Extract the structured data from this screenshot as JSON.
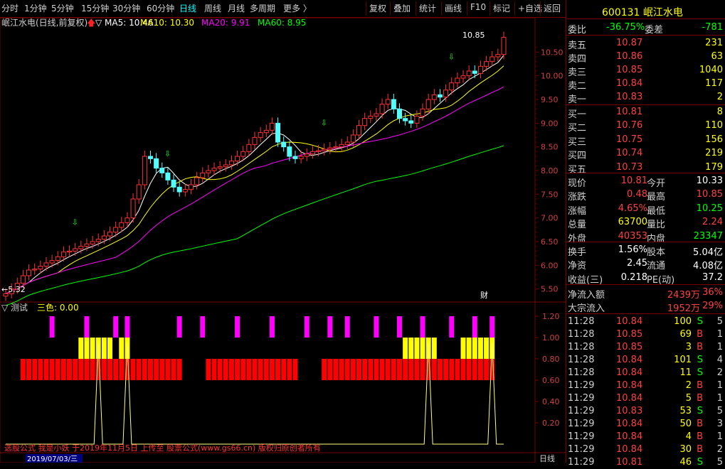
{
  "toolbar": {
    "items": [
      "分时",
      "1分钟",
      "5分钟",
      "15分钟",
      "30分钟",
      "60分钟",
      "日线",
      "周线",
      "月线",
      "多周期",
      "更多 〉"
    ],
    "active_index": 6,
    "right_items": [
      "复权",
      "叠加",
      "统计",
      "画线",
      "F10",
      "标记",
      "+自选",
      "返回"
    ]
  },
  "main_chart": {
    "title": "岷江水电(日线,前复权)",
    "ma_labels": [
      "▽ MA5: 10.46",
      "MA10: 10.30",
      "MA20: 9.91",
      "MA60: 8.95"
    ],
    "ma_colors": [
      "#ffffff",
      "#ffff00",
      "#ff00ff",
      "#00ff00"
    ],
    "price_ticks": [
      "10.50",
      "10.00",
      "9.50",
      "9.00",
      "8.50",
      "8.00",
      "7.50",
      "7.00",
      "6.50",
      "6.00",
      "5.50"
    ],
    "high_label": "10.85",
    "low_label": "5.32",
    "cai_label": "财"
  },
  "indicator": {
    "title": "▽ 测试",
    "value_label": "三色: 0.00",
    "ticks": [
      "1.20",
      "1.00",
      "0.80",
      "0.60",
      "0.40",
      "0.20"
    ],
    "date_label": "2019/07/03/三",
    "axis_right": "日线",
    "watermark": "选股公式 我是小妖 于2019年11月5日 上传至 股票公式(www.gs66.cn) 版权归原创者所有"
  },
  "panel": {
    "code": "600131",
    "name": "岷江水电",
    "weibi_label": "委比",
    "weibi_value": "-36.75%",
    "weicha_label": "委差",
    "weicha_value": "-781",
    "asks": [
      {
        "label": "卖五",
        "price": "10.87",
        "vol": "231"
      },
      {
        "label": "卖四",
        "price": "10.86",
        "vol": "63"
      },
      {
        "label": "卖三",
        "price": "10.85",
        "vol": "1040"
      },
      {
        "label": "卖二",
        "price": "10.84",
        "vol": "117"
      },
      {
        "label": "卖一",
        "price": "10.83",
        "vol": "2"
      }
    ],
    "bids": [
      {
        "label": "买一",
        "price": "10.81",
        "vol": "8"
      },
      {
        "label": "买二",
        "price": "10.76",
        "vol": "110"
      },
      {
        "label": "买三",
        "price": "10.75",
        "vol": "156"
      },
      {
        "label": "买四",
        "price": "10.74",
        "vol": "219"
      },
      {
        "label": "买五",
        "price": "10.73",
        "vol": "179"
      }
    ],
    "stats": [
      {
        "l1": "现价",
        "v1": "10.81",
        "c1": "#ff4040",
        "l2": "今开",
        "v2": "10.33",
        "c2": "#ffffff"
      },
      {
        "l1": "涨跌",
        "v1": "0.48",
        "c1": "#ff4040",
        "l2": "最高",
        "v2": "10.85",
        "c2": "#ff4040"
      },
      {
        "l1": "涨幅",
        "v1": "4.65%",
        "c1": "#ff4040",
        "l2": "最低",
        "v2": "10.25",
        "c2": "#00ff00"
      },
      {
        "l1": "总量",
        "v1": "63700",
        "c1": "#ffff00",
        "l2": "量比",
        "v2": "2.24",
        "c2": "#ff4040"
      },
      {
        "l1": "外盘",
        "v1": "40353",
        "c1": "#ff4040",
        "l2": "内盘",
        "v2": "23347",
        "c2": "#00ff00"
      }
    ],
    "fund": [
      {
        "l1": "换手",
        "v1": "1.56%",
        "l2": "股本",
        "v2": "5.04亿"
      },
      {
        "l1": "净资",
        "v1": "2.45",
        "l2": "流通",
        "v2": "4.08亿"
      },
      {
        "l1": "收益(三)",
        "v1": "0.218",
        "l2": "PE(动)",
        "v2": "37.2"
      }
    ],
    "flow": [
      {
        "label": "净流入额",
        "value": "2439万",
        "pct": "36%"
      },
      {
        "label": "大宗流入",
        "value": "1952万",
        "pct": "29%"
      }
    ],
    "ticks": [
      {
        "t": "11:28",
        "p": "10.84",
        "v": "100",
        "s": "S",
        "n": "5"
      },
      {
        "t": "11:28",
        "p": "10.85",
        "v": "69",
        "s": "B",
        "n": "1"
      },
      {
        "t": "11:28",
        "p": "10.85",
        "v": "3",
        "s": "B",
        "n": "1"
      },
      {
        "t": "11:28",
        "p": "10.84",
        "v": "101",
        "s": "S",
        "n": "4"
      },
      {
        "t": "11:28",
        "p": "10.84",
        "v": "11",
        "s": "S",
        "n": "2"
      },
      {
        "t": "11:29",
        "p": "10.84",
        "v": "2",
        "s": "B",
        "n": "1"
      },
      {
        "t": "11:29",
        "p": "10.84",
        "v": "5",
        "s": "B",
        "n": "1"
      },
      {
        "t": "11:29",
        "p": "10.83",
        "v": "53",
        "s": "S",
        "n": "5"
      },
      {
        "t": "11:29",
        "p": "10.84",
        "v": "50",
        "s": "B",
        "n": "3"
      },
      {
        "t": "11:29",
        "p": "10.84",
        "v": "4",
        "s": "B",
        "n": "1"
      },
      {
        "t": "11:29",
        "p": "10.84",
        "v": "30",
        "s": "B",
        "n": "2"
      },
      {
        "t": "11:29",
        "p": "10.81",
        "v": "46",
        "s": "S",
        "n": "5"
      }
    ]
  },
  "chart_data": {
    "type": "candlestick",
    "title": "岷江水电(日线,前复权)",
    "ylim": [
      5.3,
      11.0
    ],
    "open": [
      5.35,
      5.4,
      5.5,
      5.62,
      5.78,
      5.9,
      5.92,
      5.98,
      6.05,
      6.1,
      6.18,
      6.28,
      6.3,
      6.35,
      6.4,
      6.45,
      6.5,
      6.55,
      6.62,
      6.7,
      6.8,
      6.9,
      7.0,
      7.4,
      7.7,
      8.3,
      8.25,
      8.05,
      7.95,
      7.8,
      7.65,
      7.55,
      7.6,
      7.7,
      7.85,
      7.95,
      8.0,
      8.05,
      8.08,
      8.12,
      8.2,
      8.3,
      8.4,
      8.55,
      8.7,
      8.8,
      8.85,
      9.0,
      8.6,
      8.5,
      8.3,
      8.25,
      8.3,
      8.35,
      8.4,
      8.42,
      8.45,
      8.48,
      8.5,
      8.55,
      8.6,
      8.75,
      8.95,
      9.1,
      9.15,
      9.2,
      9.4,
      9.5,
      9.3,
      9.1,
      9.05,
      9.0,
      9.15,
      9.3,
      9.5,
      9.6,
      9.55,
      9.7,
      9.85,
      9.95,
      10.0,
      10.1,
      10.05,
      10.2,
      10.3,
      10.4,
      10.45
    ],
    "close": [
      5.4,
      5.5,
      5.62,
      5.78,
      5.9,
      5.92,
      5.98,
      6.05,
      6.1,
      6.18,
      6.28,
      6.3,
      6.35,
      6.4,
      6.45,
      6.5,
      6.55,
      6.62,
      6.7,
      6.8,
      6.9,
      7.0,
      7.4,
      7.7,
      8.3,
      8.25,
      8.05,
      7.95,
      7.8,
      7.65,
      7.55,
      7.6,
      7.7,
      7.85,
      7.95,
      8.0,
      8.05,
      8.08,
      8.12,
      8.2,
      8.3,
      8.4,
      8.55,
      8.7,
      8.8,
      8.85,
      9.0,
      8.6,
      8.5,
      8.3,
      8.25,
      8.3,
      8.35,
      8.4,
      8.42,
      8.45,
      8.48,
      8.5,
      8.55,
      8.6,
      8.75,
      8.95,
      9.1,
      9.15,
      9.2,
      9.4,
      9.5,
      9.3,
      9.1,
      9.05,
      9.0,
      9.15,
      9.3,
      9.5,
      9.6,
      9.55,
      9.7,
      9.85,
      9.95,
      10.0,
      10.1,
      10.05,
      10.2,
      10.3,
      10.4,
      10.45,
      10.81
    ],
    "indicator_magenta": [
      8,
      14,
      19,
      21,
      30,
      34,
      40,
      46,
      52,
      56,
      59,
      64,
      68,
      72,
      77,
      81,
      84
    ],
    "indicator_yellow": [
      13,
      14,
      15,
      16,
      17,
      18,
      20,
      21,
      69,
      70,
      71,
      72,
      73,
      74,
      79,
      80,
      81,
      82,
      83,
      84
    ],
    "indicator_red": [
      3,
      4,
      5,
      6,
      7,
      8,
      9,
      10,
      11,
      12,
      13,
      14,
      15,
      16,
      17,
      18,
      19,
      20,
      21,
      22,
      23,
      24,
      25,
      26,
      27,
      28,
      29,
      30,
      35,
      36,
      37,
      38,
      39,
      40,
      41,
      42,
      43,
      44,
      45,
      46,
      47,
      48,
      49,
      50,
      55,
      56,
      57,
      58,
      59,
      60,
      61,
      62,
      63,
      64,
      65,
      66,
      67,
      68,
      69,
      70,
      71,
      72,
      73,
      74,
      75,
      76,
      77,
      78,
      79,
      80,
      81,
      82,
      83,
      84
    ],
    "indicator_spikes": [
      16,
      21,
      73,
      84
    ]
  }
}
